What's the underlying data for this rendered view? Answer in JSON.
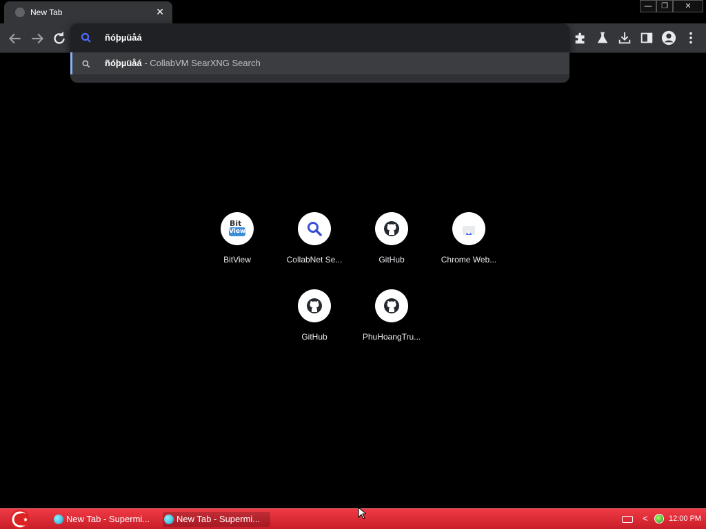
{
  "tab": {
    "title": "New Tab",
    "close": "✕"
  },
  "window_controls": {
    "minimize": "—",
    "restore": "❐",
    "close": "✕"
  },
  "omnibox": {
    "query": "ñóþµüåá",
    "suggestion_query": "ñóþµüåá",
    "suggestion_suffix": " - CollabVM SearXNG Search"
  },
  "shortcuts": [
    {
      "label": "BitView",
      "icon": "bitview-icon"
    },
    {
      "label": "CollabNet Se...",
      "icon": "search-icon"
    },
    {
      "label": "GitHub",
      "icon": "github-icon"
    },
    {
      "label": "Chrome Web...",
      "icon": "chrome-web-store-icon"
    },
    {
      "label": "GitHub",
      "icon": "github-icon"
    },
    {
      "label": "PhuHoangTru...",
      "icon": "github-icon"
    }
  ],
  "bitview_logo": {
    "line1": "Bit",
    "line2": "View"
  },
  "taskbar": {
    "items": [
      "New Tab - Supermi...",
      "New Tab - Supermi..."
    ],
    "clock": "12:00 PM",
    "tray_arrow": "<"
  },
  "colors": {
    "accent": "#8ab4f8",
    "taskbar": "#e0303c",
    "search_icon": "#4d6bff"
  }
}
